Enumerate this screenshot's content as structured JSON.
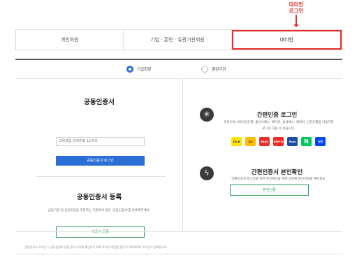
{
  "annotation": {
    "line1": "대리인",
    "line2": "로그인"
  },
  "tabs": [
    {
      "label": "개인회원"
    },
    {
      "label": "기업 · 훈련 · 유관기관회원"
    },
    {
      "label": "대리인",
      "active": true
    }
  ],
  "radios": [
    {
      "label": "기업회원",
      "checked": true
    },
    {
      "label": "훈련기관",
      "checked": false
    }
  ],
  "left": {
    "cert_title": "공동인증서",
    "input_value": "고용보험 관리번호 11자리",
    "cert_button": "공동인증서 로그인",
    "register_title": "공동인증서 등록",
    "register_desc": "금융기관 및 공인인증을 주관하는 기관에서 받은 '공동인증서'를 등록해주세요.",
    "register_button": "인증서 등록"
  },
  "right": {
    "simple_login_title": "간편인증 로그인",
    "simple_login_desc": "카카오톡, KB국민은행, 통신사패스, 페이코, 삼성패스, 네이버, 신한은행을 이용하여 로그인 하실 수 있습니다.",
    "providers": [
      {
        "name": "kakao-logo",
        "text": "TALK",
        "bg": "#fee500",
        "fg": "#3a1d1d"
      },
      {
        "name": "kb-logo",
        "text": "KB",
        "bg": "#ffbc00",
        "fg": "#5a4a2a"
      },
      {
        "name": "pass-logo",
        "text": "PASS",
        "bg": "#e8312a",
        "fg": "#ffffff"
      },
      {
        "name": "payco-logo",
        "text": "PAYCO",
        "bg": "#fa2828",
        "fg": "#ffffff"
      },
      {
        "name": "samsungpass-logo",
        "text": "Pass",
        "bg": "#1d4fa8",
        "fg": "#ffffff"
      },
      {
        "name": "naver-logo",
        "text": "N",
        "bg": "#03c75a",
        "fg": "#ffffff"
      },
      {
        "name": "shinhan-logo",
        "text": "신한",
        "bg": "#0046ff",
        "fg": "#ffffff"
      }
    ],
    "verify_title": "간편인증서 본인확인",
    "verify_desc": "간편인증서 로그인을 위한 본인확인을 위해 사전에 본인인증을 해주세요.",
    "verify_button": "본인인증"
  },
  "footnote": "·공동인증서 로그인 시 공동인증서 등을 필히 사전에 확인하기 위해 로그인 버튼을 클릭 후 계속하여야 로그인이 완료됩니다.",
  "colors": {
    "accent_red": "#e8312a",
    "primary_blue": "#2b6fd6",
    "outline_green": "#2f9a5c"
  }
}
